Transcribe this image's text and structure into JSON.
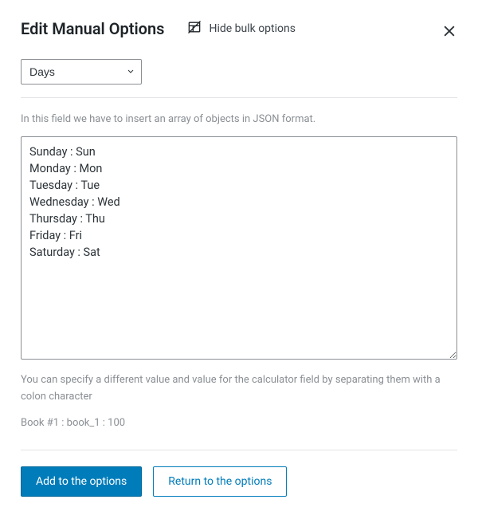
{
  "header": {
    "title": "Edit Manual Options",
    "hide_bulk_label": "Hide bulk options"
  },
  "presets": {
    "selected": "Days"
  },
  "helper_top": "In this field we have to insert an array of objects in JSON format.",
  "textarea_value": "Sunday : Sun\nMonday : Mon\nTuesday : Tue\nWednesday : Wed\nThursday : Thu\nFriday : Fri\nSaturday : Sat",
  "helper_bottom": "You can specify a different value and value for the calculator field by separating them with a colon character",
  "example_text": "Book #1 : book_1 : 100",
  "buttons": {
    "add": "Add to the options",
    "return": "Return to the options"
  },
  "colors": {
    "primary": "#007cba",
    "border": "#8c8f94",
    "muted": "#8a8f94"
  }
}
